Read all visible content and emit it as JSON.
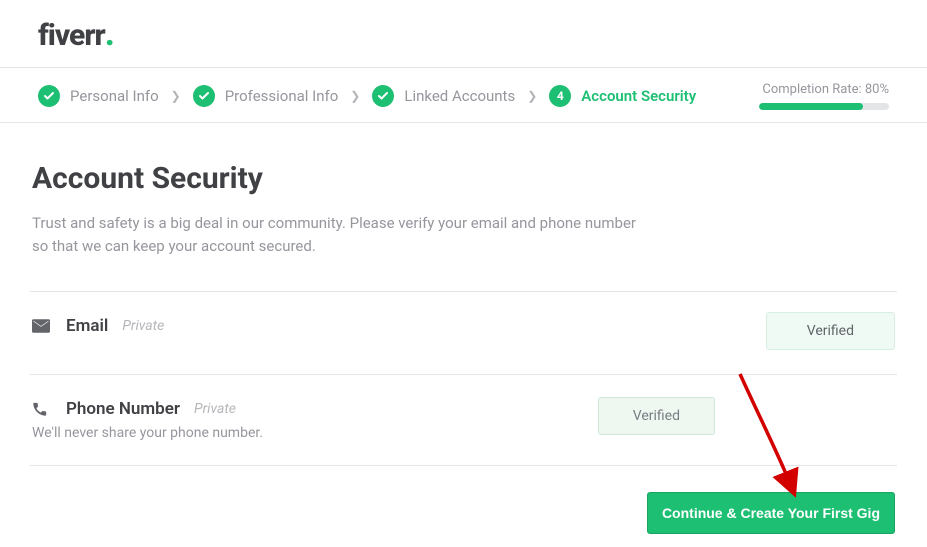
{
  "brand": {
    "name": "fiverr"
  },
  "steps": {
    "items": [
      {
        "label": "Personal Info",
        "done": true
      },
      {
        "label": "Professional Info",
        "done": true
      },
      {
        "label": "Linked Accounts",
        "done": true
      },
      {
        "label": "Account Security",
        "active": true,
        "number": "4"
      }
    ]
  },
  "completion": {
    "label": "Completion Rate: 80%",
    "percent": 80
  },
  "page": {
    "title": "Account Security",
    "subtitle": "Trust and safety is a big deal in our community. Please verify your email and phone number so that we can keep your account secured."
  },
  "email": {
    "label": "Email",
    "privacy": "Private",
    "status": "Verified"
  },
  "phone": {
    "label": "Phone Number",
    "privacy": "Private",
    "help": "We'll never share your phone number.",
    "status": "Verified"
  },
  "cta": {
    "label": "Continue & Create Your First Gig"
  }
}
